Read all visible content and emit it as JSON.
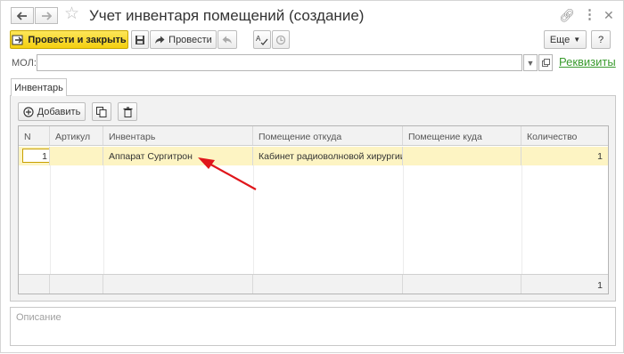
{
  "window": {
    "title": "Учет инвентаря помещений (создание)"
  },
  "toolbar": {
    "post_close_label": "Провести и закрыть",
    "post_label": "Провести",
    "more_label": "Еще",
    "help_label": "?"
  },
  "form": {
    "mol_label": "МОЛ:",
    "mol_value": "",
    "requisites_link": "Реквизиты"
  },
  "tabs": [
    {
      "label": "Инвентарь"
    }
  ],
  "inventory": {
    "add_label": "Добавить",
    "columns": [
      "N",
      "Артикул",
      "Инвентарь",
      "Помещение откуда",
      "Помещение куда",
      "Количество"
    ],
    "rows": [
      {
        "n": "1",
        "article": "",
        "item": "Аппарат Сургитрон",
        "from": "Кабинет радиоволновой хирургии",
        "to": "",
        "qty": "1"
      }
    ],
    "total_qty": "1"
  },
  "description": {
    "placeholder": "Описание"
  },
  "annotation": {
    "arrow_color": "#e0161b"
  }
}
